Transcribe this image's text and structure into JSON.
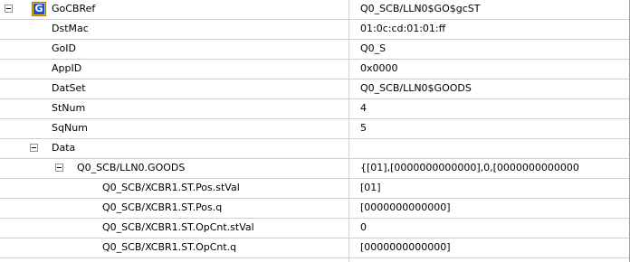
{
  "icons": {
    "goose_icon_letter": "G",
    "goose_icon_fill": "#1c4fd8",
    "goose_icon_border": "#f2c200"
  },
  "rows": [
    {
      "name": "GoCBRef",
      "value": "Q0_SCB/LLN0$GO$gcST"
    },
    {
      "name": "DstMac",
      "value": "01:0c:cd:01:01:ff"
    },
    {
      "name": "GoID",
      "value": "Q0_S"
    },
    {
      "name": "AppID",
      "value": "0x0000"
    },
    {
      "name": "DatSet",
      "value": "Q0_SCB/LLN0$GOODS"
    },
    {
      "name": "StNum",
      "value": "4"
    },
    {
      "name": "SqNum",
      "value": "5"
    },
    {
      "name": "Data",
      "value": ""
    },
    {
      "name": "Q0_SCB/LLN0.GOODS",
      "value": "{[01],[0000000000000],0,[0000000000000"
    },
    {
      "name": "Q0_SCB/XCBR1.ST.Pos.stVal",
      "value": "[01]"
    },
    {
      "name": "Q0_SCB/XCBR1.ST.Pos.q",
      "value": "[0000000000000]"
    },
    {
      "name": "Q0_SCB/XCBR1.ST.OpCnt.stVal",
      "value": "0"
    },
    {
      "name": "Q0_SCB/XCBR1.ST.OpCnt.q",
      "value": "[0000000000000]"
    }
  ]
}
